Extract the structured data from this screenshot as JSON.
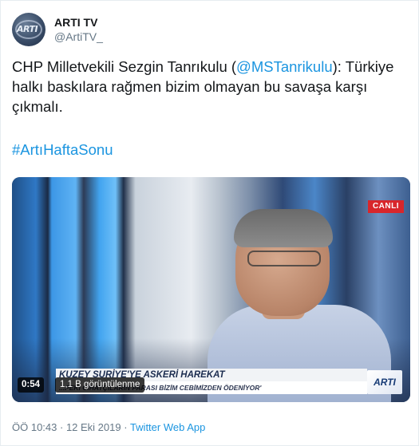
{
  "account": {
    "name": "ARTI TV",
    "handle": "@ArtiTV_",
    "avatar_logo_text": "ARTI"
  },
  "tweet": {
    "text_before_mention": "CHP Milletvekili Sezgin Tanrıkulu (",
    "mention": "@MSTanrikulu",
    "text_after_mention": "): Türkiye halkı baskılara rağmen bizim olmayan bu savaşa karşı çıkmalı.",
    "hashtag": "#ArtıHaftaSonu"
  },
  "video": {
    "live_badge": "CANLI",
    "headline": "KUZEY SURİYE'YE ASKERİ HAREKAT",
    "ticker": "...PEKİ CİHATÇILARIN PARASI BİZİM CEBİMİZDEN ÖDENİYOR'",
    "channel_logo": "ARTI",
    "duration": "0:54",
    "views": "1,1 B görüntülenme"
  },
  "meta": {
    "time": "ÖÖ 10:43",
    "separator": " · ",
    "date": "12 Eki 2019",
    "source": "Twitter Web App"
  },
  "colors": {
    "link": "#1b95e0",
    "secondary_text": "#657786",
    "live_red": "#d8262b"
  }
}
